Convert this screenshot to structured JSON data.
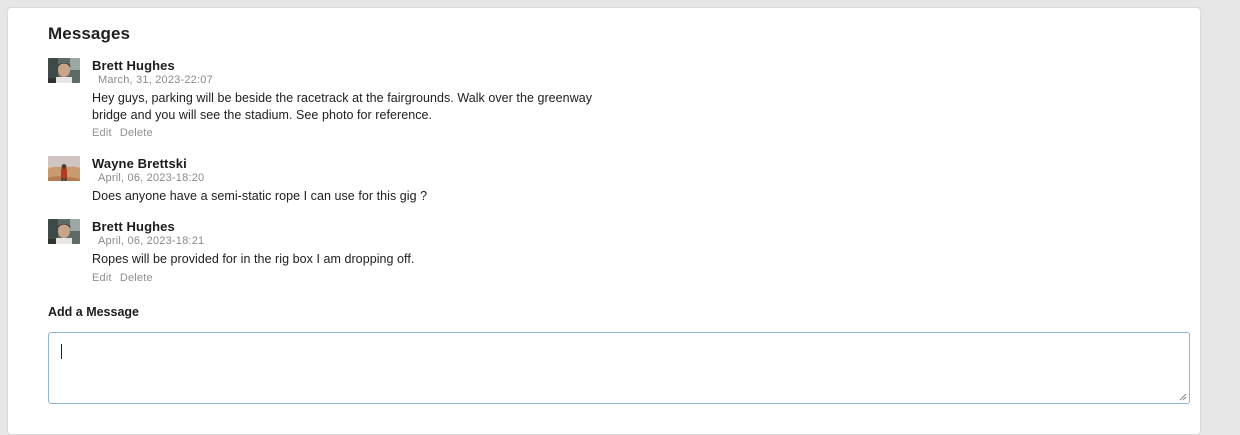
{
  "panel": {
    "title": "Messages"
  },
  "messages": [
    {
      "author": "Brett Hughes",
      "timestamp": "March, 31, 2023-22:07",
      "text_lines": [
        "Hey guys, parking will be beside the racetrack at the fairgrounds. Walk over the greenway",
        "bridge and you will see the stadium. See photo for reference."
      ],
      "actions": {
        "edit": "Edit",
        "delete": "Delete"
      },
      "avatar_icon": "user-photo-icon"
    },
    {
      "author": "Wayne Brettski",
      "timestamp": "April, 06, 2023-18:20",
      "text_lines": [
        "Does anyone have a semi-static rope I can use for this gig ?"
      ],
      "avatar_icon": "user-photo-icon"
    },
    {
      "author": "Brett Hughes",
      "timestamp": "April, 06, 2023-18:21",
      "text_lines": [
        "Ropes will be provided for in the rig box I am dropping off."
      ],
      "actions": {
        "edit": "Edit",
        "delete": "Delete"
      },
      "avatar_icon": "user-photo-icon"
    }
  ],
  "composer": {
    "label": "Add a Message",
    "value": "",
    "placeholder": ""
  },
  "colors": {
    "page_background": "#e6e6e6",
    "panel_background": "#ffffff",
    "muted_text": "#8a8a8a",
    "input_border": "#8fb6cc"
  }
}
